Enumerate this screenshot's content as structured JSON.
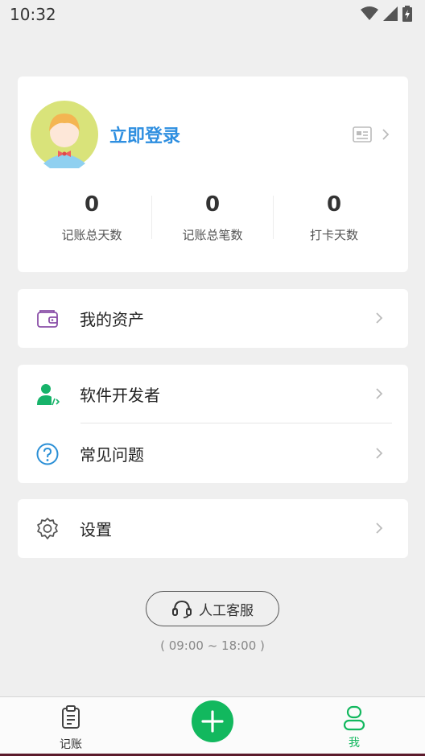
{
  "status": {
    "time": "10:32"
  },
  "profile": {
    "login_label": "立即登录",
    "stats": [
      {
        "value": "0",
        "label": "记账总天数"
      },
      {
        "value": "0",
        "label": "记账总笔数"
      },
      {
        "value": "0",
        "label": "打卡天数"
      }
    ]
  },
  "menu": {
    "assets": "我的资产",
    "developer": "软件开发者",
    "faq": "常见问题",
    "settings": "设置"
  },
  "service": {
    "label": "人工客服",
    "hours": "( 09:00 ~ 18:00 )"
  },
  "tabs": {
    "bookkeeping": "记账",
    "me": "我"
  },
  "colors": {
    "accent_green": "#12b85e",
    "login_blue": "#2f8fe0",
    "wallet_purple": "#8a4fa8",
    "faq_blue": "#2a8fd6"
  }
}
